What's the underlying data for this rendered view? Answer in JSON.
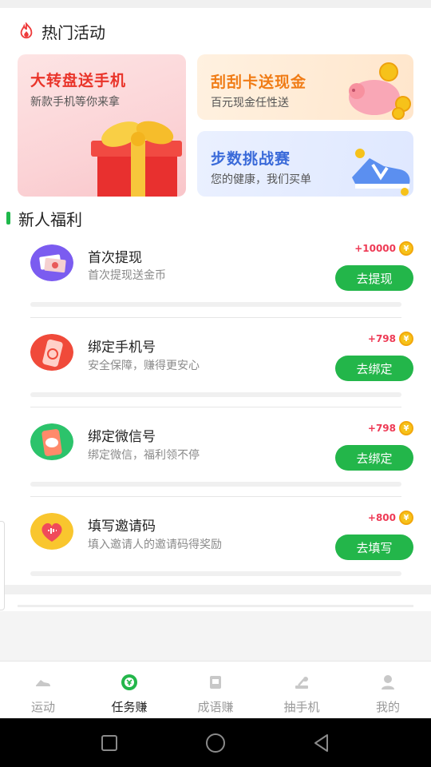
{
  "hot": {
    "title": "热门活动",
    "cards": [
      {
        "title": "大转盘送手机",
        "subtitle": "新款手机等你来拿"
      },
      {
        "title": "刮刮卡送现金",
        "subtitle": "百元现金任性送"
      },
      {
        "title": "步数挑战赛",
        "subtitle": "您的健康，我们买单"
      }
    ]
  },
  "newuser": {
    "title": "新人福利",
    "coin_symbol": "¥",
    "tasks": [
      {
        "name": "首次提现",
        "desc": "首次提现送金币",
        "reward": "+10000",
        "button": "去提现",
        "icon": "cash-icon",
        "progress": 0
      },
      {
        "name": "绑定手机号",
        "desc": "安全保障，赚得更安心",
        "reward": "+798",
        "button": "去绑定",
        "icon": "phone-icon",
        "progress": 0
      },
      {
        "name": "绑定微信号",
        "desc": "绑定微信，福利领不停",
        "reward": "+798",
        "button": "去绑定",
        "icon": "wechat-icon",
        "progress": 0
      },
      {
        "name": "填写邀请码",
        "desc": "填入邀请人的邀请码得奖励",
        "reward": "+800",
        "button": "去填写",
        "icon": "heart-icon",
        "progress": 0
      }
    ]
  },
  "tabs": [
    {
      "label": "运动",
      "icon": "shoe-icon",
      "active": false
    },
    {
      "label": "任务赚",
      "icon": "coin-icon",
      "active": true
    },
    {
      "label": "成语赚",
      "icon": "book-icon",
      "active": false
    },
    {
      "label": "抽手机",
      "icon": "claw-icon",
      "active": false
    },
    {
      "label": "我的",
      "icon": "user-icon",
      "active": false
    }
  ],
  "colors": {
    "accent": "#23b64a",
    "reward": "#ee3a55",
    "coin": "#f6c21a"
  }
}
